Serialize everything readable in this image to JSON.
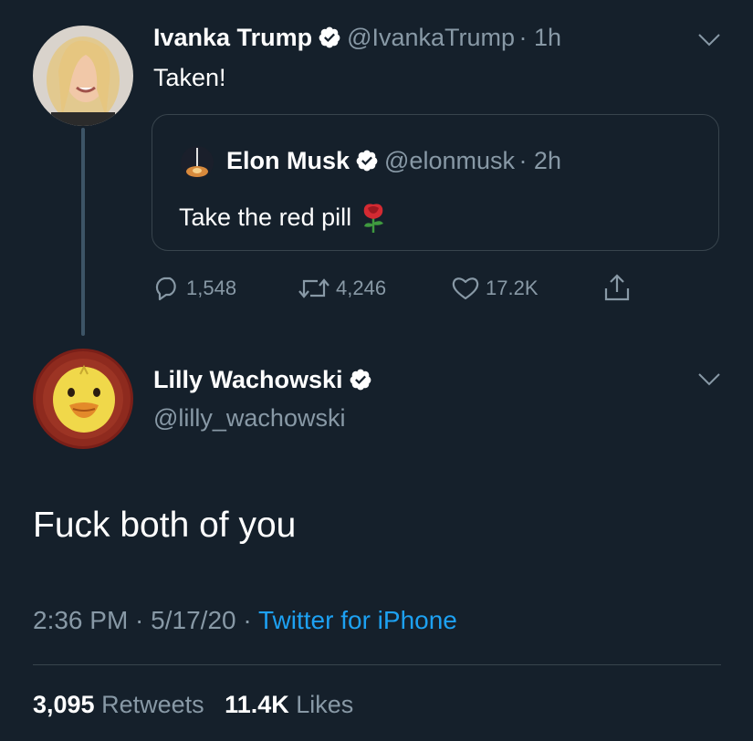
{
  "tweet1": {
    "name": "Ivanka Trump",
    "handle": "@IvankaTrump",
    "time": "· 1h",
    "text": "Taken!",
    "quote": {
      "name": "Elon Musk",
      "handle": "@elonmusk",
      "time": "· 2h",
      "text": "Take the red pill"
    },
    "actions": {
      "replies": "1,548",
      "retweets": "4,246",
      "likes": "17.2K"
    }
  },
  "tweet2": {
    "name": "Lilly Wachowski",
    "handle": "@lilly_wachowski",
    "text": "Fuck both of you",
    "time": "2:36 PM",
    "date": "5/17/20",
    "source": "Twitter for iPhone",
    "retweets_count": "3,095",
    "retweets_label": "Retweets",
    "likes_count": "11.4K",
    "likes_label": "Likes"
  },
  "colors": {
    "background": "#15202b",
    "secondary_text": "#8899a6",
    "link": "#1da1f2",
    "border": "#38444d"
  }
}
